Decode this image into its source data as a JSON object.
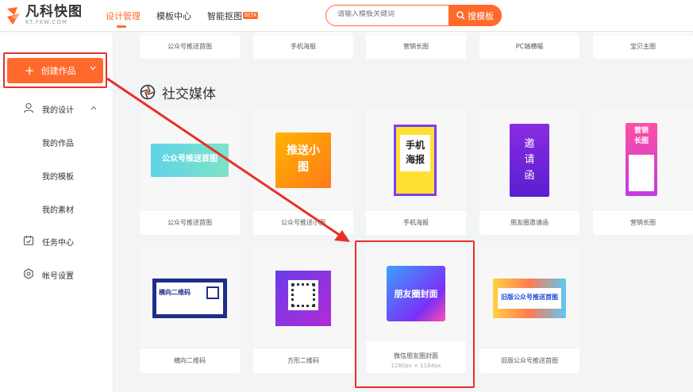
{
  "header": {
    "logo_cn": "凡科快图",
    "logo_en": "KT.FKW.COM",
    "nav": [
      {
        "label": "设计管理",
        "active": true
      },
      {
        "label": "模板中心",
        "active": false
      },
      {
        "label": "智能抠图",
        "active": false
      }
    ],
    "beta_badge": "BETA",
    "search_placeholder": "请输入模板关键词",
    "search_button": "搜模板"
  },
  "sidebar": {
    "create_button": "创建作品",
    "items": [
      {
        "label": "我的设计",
        "icon": "user-icon",
        "expanded": true
      },
      {
        "label": "我的作品"
      },
      {
        "label": "我的模板"
      },
      {
        "label": "我的素材"
      },
      {
        "label": "任务中心",
        "icon": "task-icon"
      },
      {
        "label": "帐号设置",
        "icon": "settings-icon"
      }
    ]
  },
  "top_row": [
    "公众号推送首图",
    "手机海报",
    "营销长图",
    "PC端横幅",
    "宝贝主图"
  ],
  "section": {
    "title": "社交媒体",
    "icon": "aperture-icon"
  },
  "social_row1": [
    {
      "label": "公众号推送首图",
      "thumb_text": "公众号推送首图"
    },
    {
      "label": "公众号推送小图",
      "thumb_text": "推送小图"
    },
    {
      "label": "手机海报",
      "thumb_text": "手机海报"
    },
    {
      "label": "朋友圈邀请函",
      "thumb_text": "邀请函"
    },
    {
      "label": "营销长图",
      "thumb_text": "营销长图"
    }
  ],
  "social_row2": [
    {
      "label": "横向二维码",
      "thumb_text": "横向二维码"
    },
    {
      "label": "方形二维码",
      "thumb_text": ""
    },
    {
      "label": "微信朋友圈封面",
      "sub": "1280px × 1184px",
      "thumb_text": "朋友圈封面"
    },
    {
      "label": "旧版公众号推送首图",
      "thumb_text": "旧版公众号推送首图"
    }
  ],
  "colors": {
    "accent": "#ff6a2c",
    "annotation_red": "#e8302a"
  }
}
